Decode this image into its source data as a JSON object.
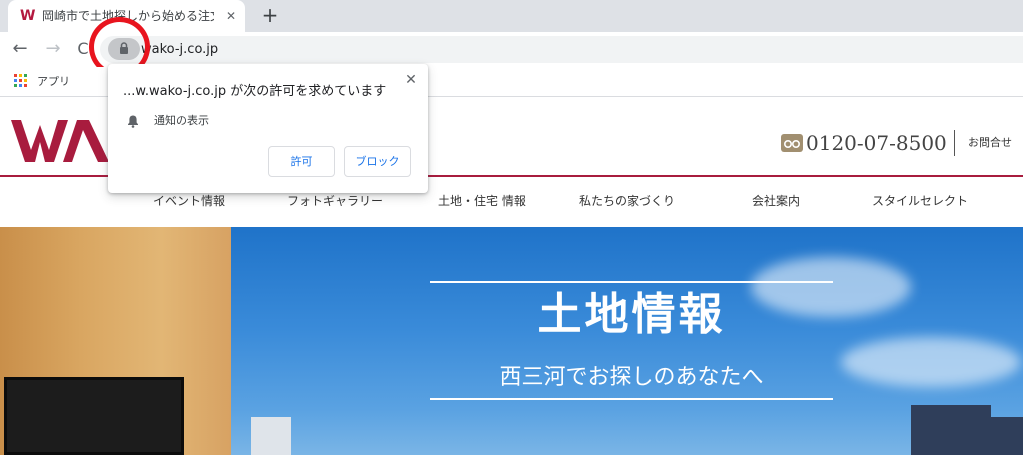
{
  "browser": {
    "tab": {
      "title": "岡崎市で土地探しから始める注文住宅",
      "favicon_letter": "W",
      "close_glyph": "✕"
    },
    "new_tab_glyph": "+",
    "nav": {
      "back_glyph": "←",
      "forward_glyph": "→",
      "reload_glyph": "C"
    },
    "url": "wako-j.co.jp",
    "bookmarks": {
      "apps_label": "アプリ"
    }
  },
  "permission_popup": {
    "title": "...w.wako-j.co.jp が次の許可を求めています",
    "permission_label": "通知の表示",
    "close_glyph": "✕",
    "allow_label": "許可",
    "block_label": "ブロック",
    "accent_color": "#1a73e8"
  },
  "site": {
    "logo_text": "WA",
    "brand_color": "#a81c3e",
    "phone": "0120-07-8500",
    "contact_label": "お問合せ",
    "nav_items": [
      "イベント情報",
      "フォトギャラリー",
      "土地・住宅 情報",
      "私たちの家づくり",
      "会社案内",
      "スタイルセレクト"
    ],
    "hero": {
      "title": "土地情報",
      "subtitle": "西三河でお探しのあなたへ"
    }
  },
  "annotation": {
    "type": "circle",
    "color": "#e8141e",
    "target": "lock-icon"
  },
  "icons": [
    "lock-icon",
    "apps-icon",
    "bell-icon",
    "free-dial-icon",
    "close-icon",
    "back-arrow-icon",
    "forward-arrow-icon",
    "reload-icon",
    "plus-icon"
  ]
}
